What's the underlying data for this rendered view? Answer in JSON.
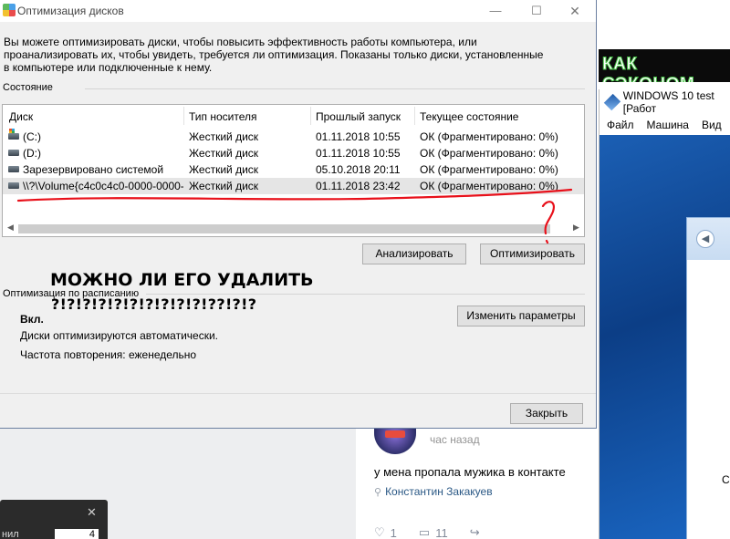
{
  "dialog": {
    "title": "Оптимизация дисков",
    "intro": "Вы можете оптимизировать диски, чтобы повысить эффективность работы  компьютера, или проанализировать их, чтобы увидеть, требуется ли оптимизация. Показаны только диски, установленные в компьютере или подключенные к нему.",
    "status_label": "Состояние",
    "columns": [
      "Диск",
      "Тип носителя",
      "Прошлый запуск",
      "Текущее состояние"
    ],
    "rows": [
      {
        "icon": "windows-drive-icon",
        "disk": "(C:)",
        "media": "Жесткий диск",
        "last_run": "01.11.2018 10:55",
        "status": "ОК (Фрагментировано: 0%)"
      },
      {
        "icon": "drive-icon",
        "disk": "(D:)",
        "media": "Жесткий диск",
        "last_run": "01.11.2018 10:55",
        "status": "ОК (Фрагментировано: 0%)"
      },
      {
        "icon": "drive-icon",
        "disk": "Зарезервировано системой",
        "media": "Жесткий диск",
        "last_run": "05.10.2018 20:11",
        "status": "ОК (Фрагментировано: 0%)"
      },
      {
        "icon": "drive-icon",
        "disk": "\\\\?\\Volume{c4c0c4c0-0000-0000-...",
        "media": "Жесткий диск",
        "last_run": "01.11.2018 23:42",
        "status": "ОК (Фрагментировано: 0%)",
        "selected": true
      }
    ],
    "analyze_button": "Анализировать",
    "optimize_button": "Оптимизировать",
    "schedule_label": "Оптимизация по расписанию",
    "schedule_state": "Вкл.",
    "change_params_button": "Изменить параметры",
    "schedule_line1": "Диски оптимизируются автоматически.",
    "schedule_line2": "Частота повторения: еженедельно",
    "close_button": "Закрыть",
    "window_buttons": {
      "minimize": "—",
      "maximize": "☐",
      "close": "✕"
    }
  },
  "annotation": {
    "line1": "МОЖНО ЛИ ЕГО УДАЛИТЬ",
    "line2": "?!?!?!?!?!?!?!?!?!?!??!?!?",
    "color": "#e8101a"
  },
  "feed": {
    "time": "час назад",
    "text": "у мена пропала мужика в контакте",
    "author": "Константин Закакуев",
    "likes": "1",
    "comments": "11"
  },
  "dark_panel": {
    "close": "✕",
    "label": "нил",
    "value": "4"
  },
  "right": {
    "banner": "КАК СЭКОНОМ",
    "vbox_title": "WINDOWS 10 test [Работ",
    "vbox_menu": [
      "Файл",
      "Машина",
      "Вид"
    ],
    "window_letter": "С"
  }
}
